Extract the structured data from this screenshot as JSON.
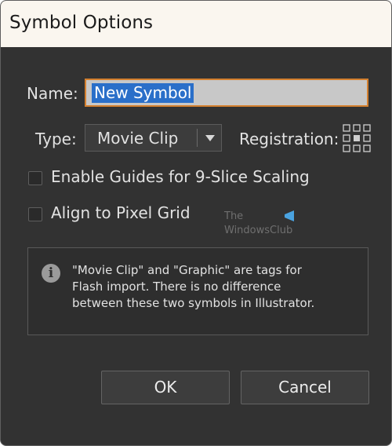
{
  "dialog": {
    "title": "Symbol Options"
  },
  "name": {
    "label": "Name:",
    "value": "New Symbol"
  },
  "type": {
    "label": "Type:",
    "value": "Movie Clip"
  },
  "registration": {
    "label": "Registration:"
  },
  "options": {
    "guides_label": "Enable Guides for 9-Slice Scaling",
    "guides_checked": false,
    "pixel_grid_label": "Align to Pixel Grid",
    "pixel_grid_checked": false
  },
  "watermark": {
    "line1": "The",
    "line2": "WindowsClub"
  },
  "info": {
    "icon": "info-icon",
    "line1": "\"Movie Clip\" and \"Graphic\" are tags for",
    "line2": "Flash import. There is no difference",
    "line3": "between these two symbols in Illustrator."
  },
  "buttons": {
    "ok": "OK",
    "cancel": "Cancel"
  },
  "colors": {
    "accent_border": "#d4802f",
    "selection": "#2a6fc9",
    "dialog_bg": "#323232"
  }
}
